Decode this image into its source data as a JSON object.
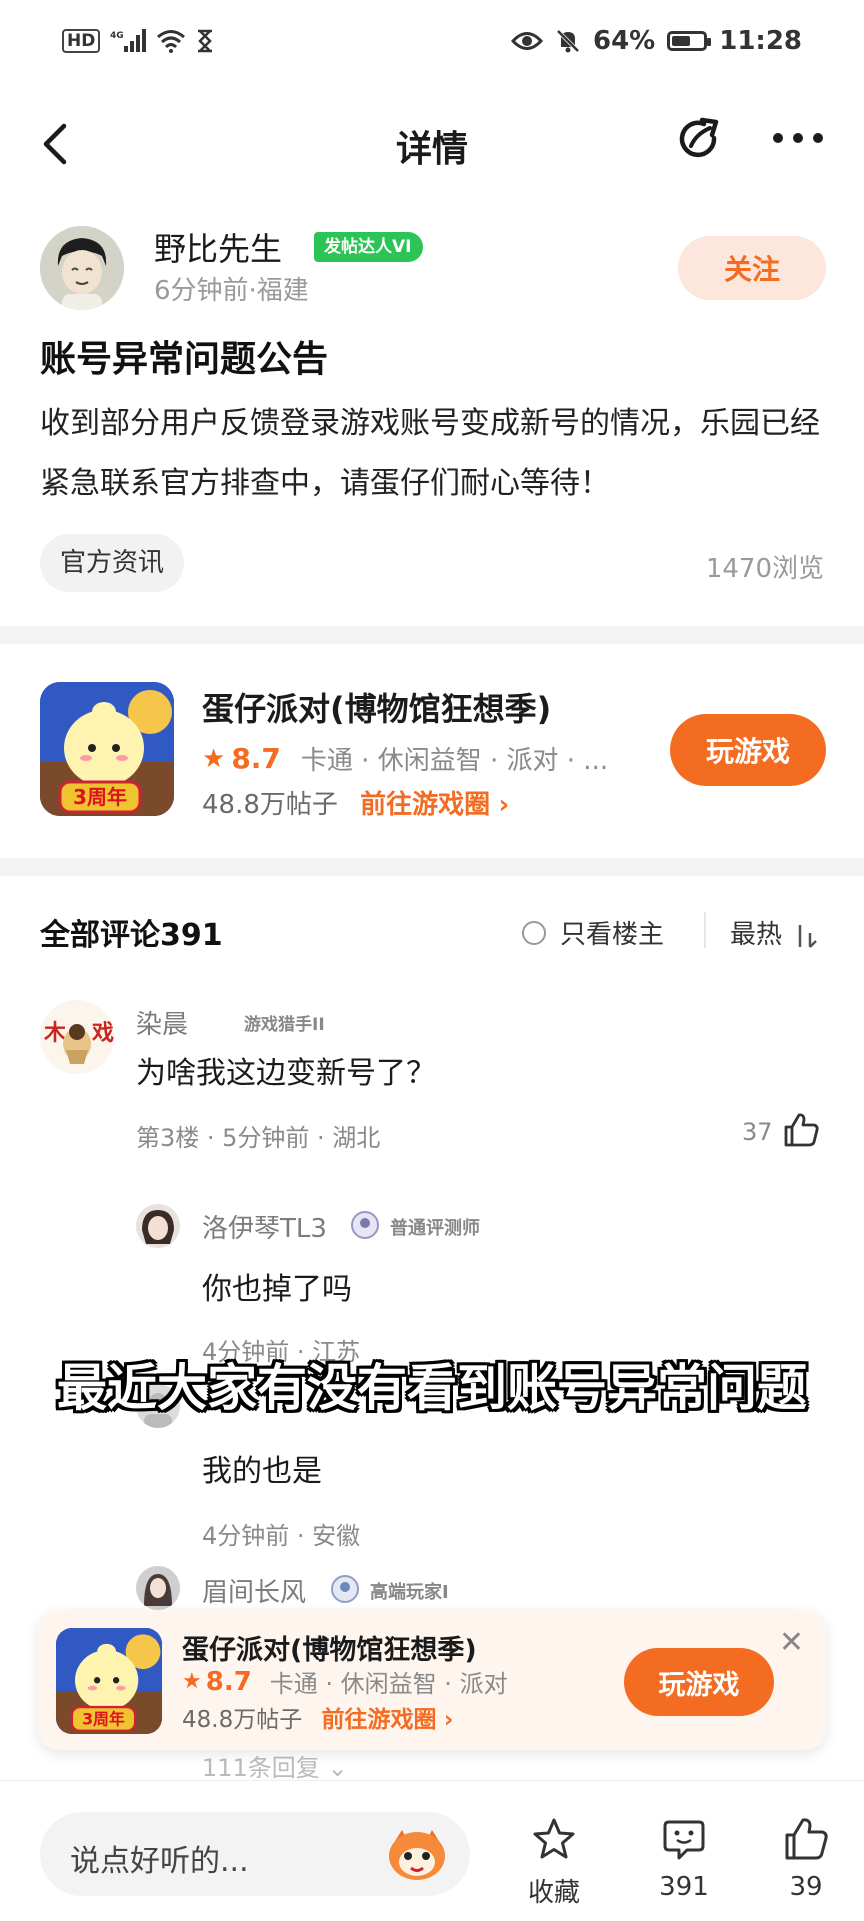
{
  "status_bar": {
    "network": "4G",
    "hd": "HD",
    "battery_percent": "64%",
    "battery_level": 0.64,
    "time": "11:28"
  },
  "nav": {
    "title": "详情"
  },
  "post": {
    "author": "野比先生",
    "author_badge": "发帖达人VI",
    "meta": "6分钟前·福建",
    "follow_label": "关注",
    "title": "账号异常问题公告",
    "body": "收到部分用户反馈登录游戏账号变成新号的情况，乐园已经紧急联系官方排查中，请蛋仔们耐心等待！",
    "tag": "官方资讯",
    "views": "1470浏览"
  },
  "game": {
    "name": "蛋仔派对(博物馆狂想季)",
    "rating": "8.7",
    "genres": "卡通 · 休闲益智 · 派对 · ...",
    "posts": "48.8万帖子",
    "link": "前往游戏圈",
    "play_label": "玩游戏",
    "icon_text": "3周年"
  },
  "comments_header": {
    "title": "全部评论391",
    "only_owner": "只看楼主",
    "sort": "最热",
    "sort_icon": "sort-icon"
  },
  "comments": [
    {
      "name": "染晨",
      "badge": "游戏猎手II",
      "text": "为啥我这边变新号了？",
      "meta": "第3楼 · 5分钟前 · 湖北",
      "likes": "37"
    }
  ],
  "replies": [
    {
      "name": "洛伊琴TL3",
      "badge": "普通评测师",
      "text": "你也掉了吗",
      "meta": "4分钟前 · 江苏"
    },
    {
      "name": "",
      "badge": "",
      "text": "我的也是",
      "meta": "4分钟前 · 安徽"
    },
    {
      "name": "眉间长风",
      "badge": "高端玩家I",
      "text": "",
      "meta": ""
    }
  ],
  "more_replies": "111条回复",
  "subtitle": "最近大家有没有看到账号异常问题",
  "floating_card": {
    "name": "蛋仔派对(博物馆狂想季)",
    "rating": "8.7",
    "genres": "卡通 · 休闲益智 · 派对",
    "posts": "48.8万帖子",
    "link": "前往游戏圈",
    "play_label": "玩游戏",
    "icon_text": "3周年"
  },
  "bottom_bar": {
    "input_placeholder": "说点好听的...",
    "favorite_label": "收藏",
    "comment_count": "391",
    "like_count": "39"
  },
  "colors": {
    "accent": "#f36c21",
    "badge_green": "#2cc456",
    "follow_bg": "#fde6dc"
  }
}
